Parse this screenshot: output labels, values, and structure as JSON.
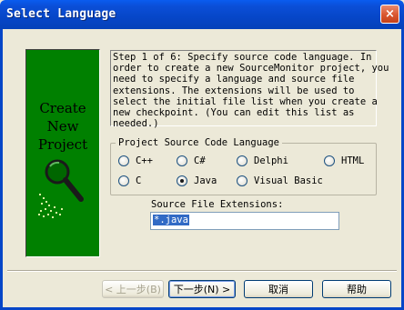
{
  "window": {
    "title": "Select Language",
    "close_label": "×"
  },
  "logo": {
    "lines": [
      "Create",
      "New",
      "Project"
    ],
    "icon": "magnifier-icon"
  },
  "step": {
    "text": "Step 1 of 6: Specify source code language. In\norder to create a new SourceMonitor project, you\nneed to specify a language and source file\nextensions. The extensions will be used to\nselect the initial file list when you create a\nnew checkpoint. (You can edit this list as\nneeded.)"
  },
  "language_group": {
    "title": "Project Source Code Language",
    "options": [
      {
        "label": "C++",
        "checked": false
      },
      {
        "label": "C#",
        "checked": false
      },
      {
        "label": "Delphi",
        "checked": false
      },
      {
        "label": "HTML",
        "checked": false
      },
      {
        "label": "C",
        "checked": false
      },
      {
        "label": "Java",
        "checked": true
      },
      {
        "label": "Visual Basic",
        "checked": false
      }
    ]
  },
  "extensions": {
    "label": "Source File Extensions:",
    "value": "*.java"
  },
  "buttons": {
    "back": "< 上一步(B)",
    "next": "下一步(N) >",
    "cancel": "取消",
    "help": "帮助"
  }
}
